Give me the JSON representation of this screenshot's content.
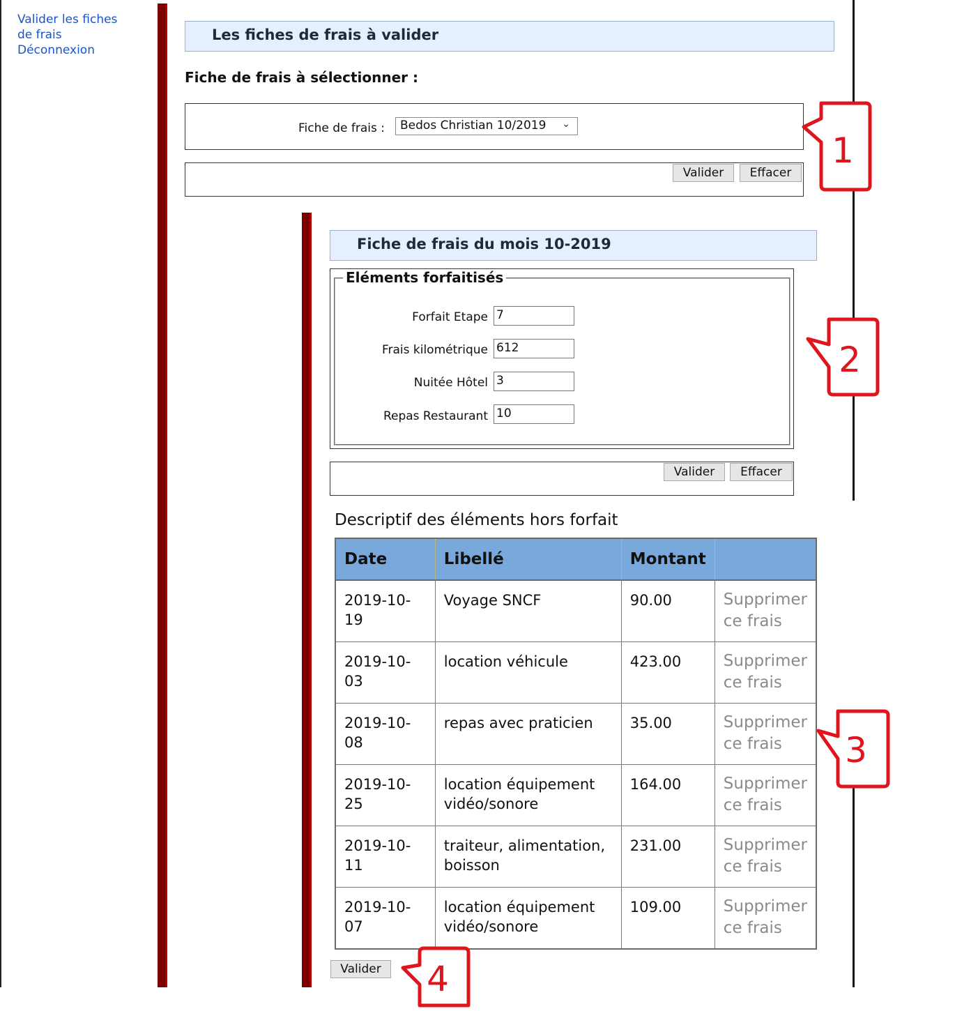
{
  "nav": {
    "link1": "Valider les fiches de frais",
    "link2": "Déconnexion"
  },
  "header": {
    "title": "Les fiches de frais à valider"
  },
  "selection": {
    "heading": "Fiche de frais à sélectionner :",
    "label": "Fiche de frais :",
    "selected": "Bedos Christian 10/2019",
    "validate": "Valider",
    "clear": "Effacer"
  },
  "fiche": {
    "title": "Fiche de frais du mois 10-2019",
    "legend": "Eléments forfaitisés",
    "rows": [
      {
        "label": "Forfait Etape",
        "value": "7"
      },
      {
        "label": "Frais kilométrique",
        "value": "612"
      },
      {
        "label": "Nuitée Hôtel",
        "value": "3"
      },
      {
        "label": "Repas Restaurant",
        "value": "10"
      }
    ],
    "validate": "Valider",
    "clear": "Effacer"
  },
  "hors_forfait": {
    "title": "Descriptif des éléments hors forfait",
    "columns": [
      "Date",
      "Libellé",
      "Montant",
      ""
    ],
    "rows": [
      {
        "date": "2019-10-19",
        "libelle": "Voyage SNCF",
        "montant": "90.00",
        "action": "Supprimer ce frais"
      },
      {
        "date": "2019-10-03",
        "libelle": "location véhicule",
        "montant": "423.00",
        "action": "Supprimer ce frais"
      },
      {
        "date": "2019-10-08",
        "libelle": "repas avec praticien",
        "montant": "35.00",
        "action": "Supprimer ce frais"
      },
      {
        "date": "2019-10-25",
        "libelle": "location équipement vidéo/sonore",
        "montant": "164.00",
        "action": "Supprimer ce frais"
      },
      {
        "date": "2019-10-11",
        "libelle": "traiteur, alimentation, boisson",
        "montant": "231.00",
        "action": "Supprimer ce frais"
      },
      {
        "date": "2019-10-07",
        "libelle": "location équipement vidéo/sonore",
        "montant": "109.00",
        "action": "Supprimer ce frais"
      }
    ],
    "validate": "Valider"
  },
  "callouts": [
    "1",
    "2",
    "3",
    "4"
  ],
  "colors": {
    "callout": "#e0141c",
    "bar": "#7c0000",
    "table_header": "#78a8dc",
    "title_bg": "#e6efff"
  }
}
